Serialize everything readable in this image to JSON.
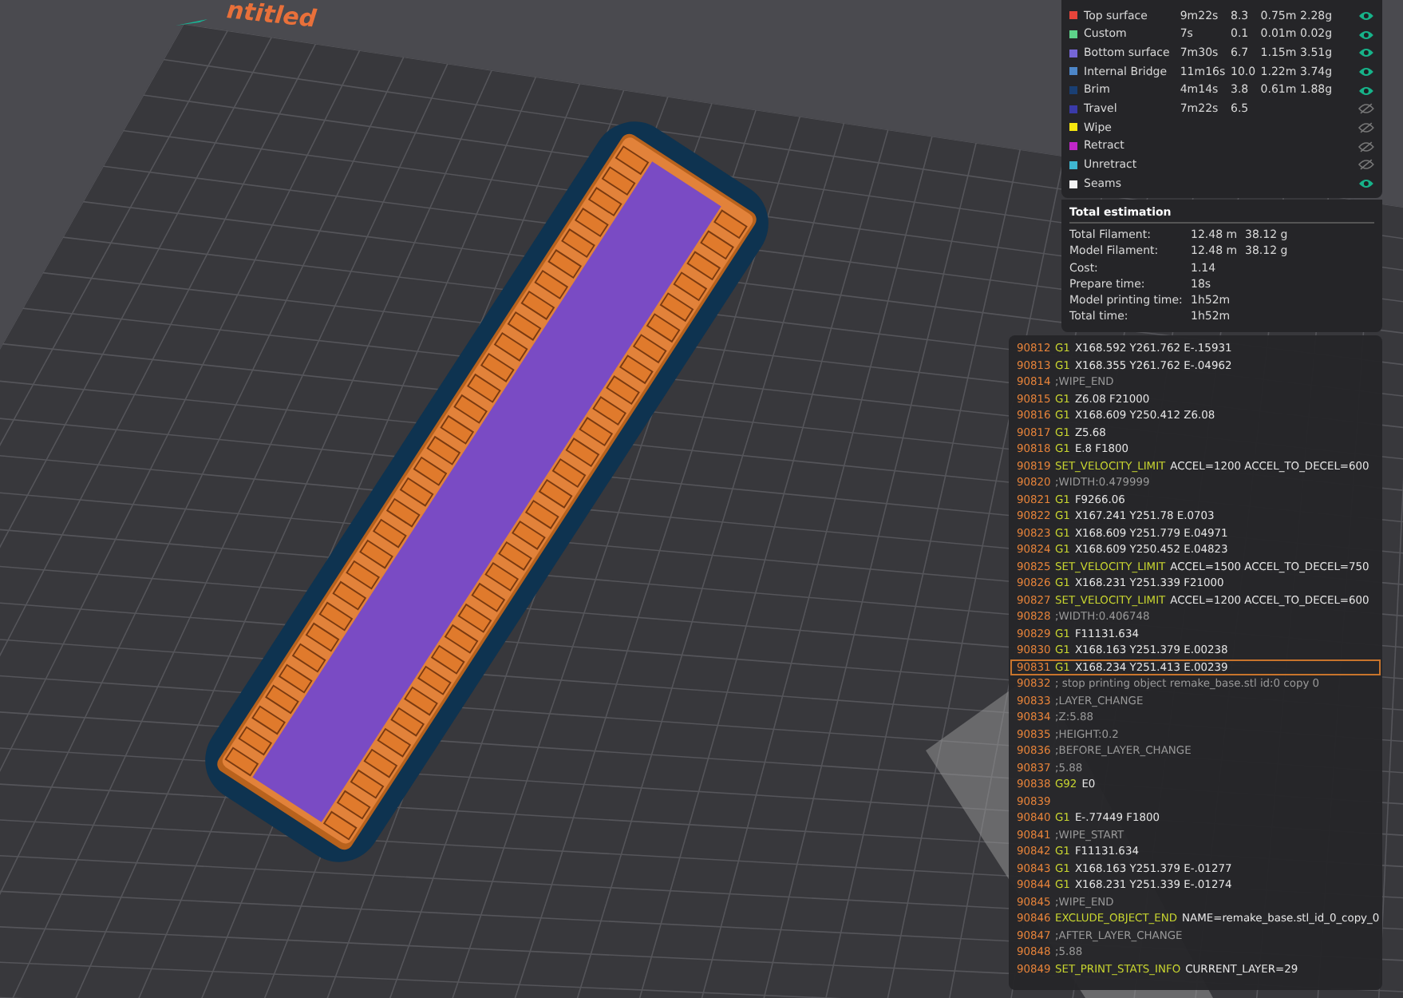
{
  "plate": {
    "title": "ntitled"
  },
  "legend": {
    "rows": [
      {
        "name": "Top surface",
        "color": "#e8443a",
        "time": "9m22s",
        "percent": "8.3",
        "length": "0.75m",
        "weight": "2.28g",
        "visible": true
      },
      {
        "name": "Custom",
        "color": "#5ed28a",
        "time": "7s",
        "percent": "0.1",
        "length": "0.01m",
        "weight": "0.02g",
        "visible": true
      },
      {
        "name": "Bottom surface",
        "color": "#7566d6",
        "time": "7m30s",
        "percent": "6.7",
        "length": "1.15m",
        "weight": "3.51g",
        "visible": true
      },
      {
        "name": "Internal Bridge",
        "color": "#4d86c8",
        "time": "11m16s",
        "percent": "10.0",
        "length": "1.22m",
        "weight": "3.74g",
        "visible": true
      },
      {
        "name": "Brim",
        "color": "#1a3f73",
        "time": "4m14s",
        "percent": "3.8",
        "length": "0.61m",
        "weight": "1.88g",
        "visible": true
      },
      {
        "name": "Travel",
        "color": "#3a3aa8",
        "time": "7m22s",
        "percent": "6.5",
        "visible": false
      },
      {
        "name": "Wipe",
        "color": "#f5e60f",
        "visible": false
      },
      {
        "name": "Retract",
        "color": "#c026c8",
        "visible": false
      },
      {
        "name": "Unretract",
        "color": "#3fb6d0",
        "visible": false
      },
      {
        "name": "Seams",
        "color": "#f2f2f2",
        "visible": true
      }
    ]
  },
  "total_estimation": {
    "title": "Total estimation",
    "rows": [
      {
        "label": "Total Filament:",
        "values": [
          "12.48 m",
          "38.12 g"
        ]
      },
      {
        "label": "Model Filament:",
        "values": [
          "12.48 m",
          "38.12 g"
        ]
      },
      {
        "label": "Cost:",
        "values": [
          "1.14"
        ]
      },
      {
        "label": "Prepare time:",
        "values": [
          "18s"
        ]
      },
      {
        "label": "Model printing time:",
        "values": [
          "1h52m"
        ]
      },
      {
        "label": "Total time:",
        "values": [
          "1h52m"
        ]
      }
    ]
  },
  "gcode": {
    "lines": [
      {
        "number": "90812",
        "kind": "command",
        "command": "G1",
        "args": "X168.592 Y261.762 E-.15931",
        "selected": false
      },
      {
        "number": "90813",
        "kind": "command",
        "command": "G1",
        "args": "X168.355 Y261.762 E-.04962",
        "selected": false
      },
      {
        "number": "90814",
        "kind": "comment",
        "text": ";WIPE_END",
        "selected": false
      },
      {
        "number": "90815",
        "kind": "command",
        "command": "G1",
        "args": "Z6.08 F21000",
        "selected": false
      },
      {
        "number": "90816",
        "kind": "command",
        "command": "G1",
        "args": "X168.609 Y250.412 Z6.08",
        "selected": false
      },
      {
        "number": "90817",
        "kind": "command",
        "command": "G1",
        "args": "Z5.68",
        "selected": false
      },
      {
        "number": "90818",
        "kind": "command",
        "command": "G1",
        "args": "E.8 F1800",
        "selected": false
      },
      {
        "number": "90819",
        "kind": "command",
        "command": "SET_VELOCITY_LIMIT",
        "args": "ACCEL=1200 ACCEL_TO_DECEL=600",
        "selected": false
      },
      {
        "number": "90820",
        "kind": "comment",
        "text": ";WIDTH:0.479999",
        "selected": false
      },
      {
        "number": "90821",
        "kind": "command",
        "command": "G1",
        "args": "F9266.06",
        "selected": false
      },
      {
        "number": "90822",
        "kind": "command",
        "command": "G1",
        "args": "X167.241 Y251.78 E.0703",
        "selected": false
      },
      {
        "number": "90823",
        "kind": "command",
        "command": "G1",
        "args": "X168.609 Y251.779 E.04971",
        "selected": false
      },
      {
        "number": "90824",
        "kind": "command",
        "command": "G1",
        "args": "X168.609 Y250.452 E.04823",
        "selected": false
      },
      {
        "number": "90825",
        "kind": "command",
        "command": "SET_VELOCITY_LIMIT",
        "args": "ACCEL=1500 ACCEL_TO_DECEL=750",
        "selected": false
      },
      {
        "number": "90826",
        "kind": "command",
        "command": "G1",
        "args": "X168.231 Y251.339 F21000",
        "selected": false
      },
      {
        "number": "90827",
        "kind": "command",
        "command": "SET_VELOCITY_LIMIT",
        "args": "ACCEL=1200 ACCEL_TO_DECEL=600",
        "selected": false
      },
      {
        "number": "90828",
        "kind": "comment",
        "text": ";WIDTH:0.406748",
        "selected": false
      },
      {
        "number": "90829",
        "kind": "command",
        "command": "G1",
        "args": "F11131.634",
        "selected": false
      },
      {
        "number": "90830",
        "kind": "command",
        "command": "G1",
        "args": "X168.163 Y251.379 E.00238",
        "selected": false
      },
      {
        "number": "90831",
        "kind": "command",
        "command": "G1",
        "args": "X168.234 Y251.413 E.00239",
        "selected": true
      },
      {
        "number": "90832",
        "kind": "comment",
        "text": "; stop printing object remake_base.stl id:0 copy 0",
        "selected": false
      },
      {
        "number": "90833",
        "kind": "comment",
        "text": ";LAYER_CHANGE",
        "selected": false
      },
      {
        "number": "90834",
        "kind": "comment",
        "text": ";Z:5.88",
        "selected": false
      },
      {
        "number": "90835",
        "kind": "comment",
        "text": ";HEIGHT:0.2",
        "selected": false
      },
      {
        "number": "90836",
        "kind": "comment",
        "text": ";BEFORE_LAYER_CHANGE",
        "selected": false
      },
      {
        "number": "90837",
        "kind": "comment",
        "text": ";5.88",
        "selected": false
      },
      {
        "number": "90838",
        "kind": "command",
        "command": "G92",
        "args": "E0",
        "selected": false
      },
      {
        "number": "90839",
        "kind": "empty",
        "selected": false
      },
      {
        "number": "90840",
        "kind": "command",
        "command": "G1",
        "args": "E-.77449 F1800",
        "selected": false
      },
      {
        "number": "90841",
        "kind": "comment",
        "text": ";WIPE_START",
        "selected": false
      },
      {
        "number": "90842",
        "kind": "command",
        "command": "G1",
        "args": "F11131.634",
        "selected": false
      },
      {
        "number": "90843",
        "kind": "command",
        "command": "G1",
        "args": "X168.163 Y251.379 E-.01277",
        "selected": false
      },
      {
        "number": "90844",
        "kind": "command",
        "command": "G1",
        "args": "X168.231 Y251.339 E-.01274",
        "selected": false
      },
      {
        "number": "90845",
        "kind": "comment",
        "text": ";WIPE_END",
        "selected": false
      },
      {
        "number": "90846",
        "kind": "command",
        "command": "EXCLUDE_OBJECT_END",
        "args": "NAME=remake_base.stl_id_0_copy_0",
        "selected": false
      },
      {
        "number": "90847",
        "kind": "comment",
        "text": ";AFTER_LAYER_CHANGE",
        "selected": false
      },
      {
        "number": "90848",
        "kind": "comment",
        "text": ";5.88",
        "selected": false
      },
      {
        "number": "90849",
        "kind": "command",
        "command": "SET_PRINT_STATS_INFO",
        "args": "CURRENT_LAYER=29",
        "selected": false
      }
    ]
  }
}
